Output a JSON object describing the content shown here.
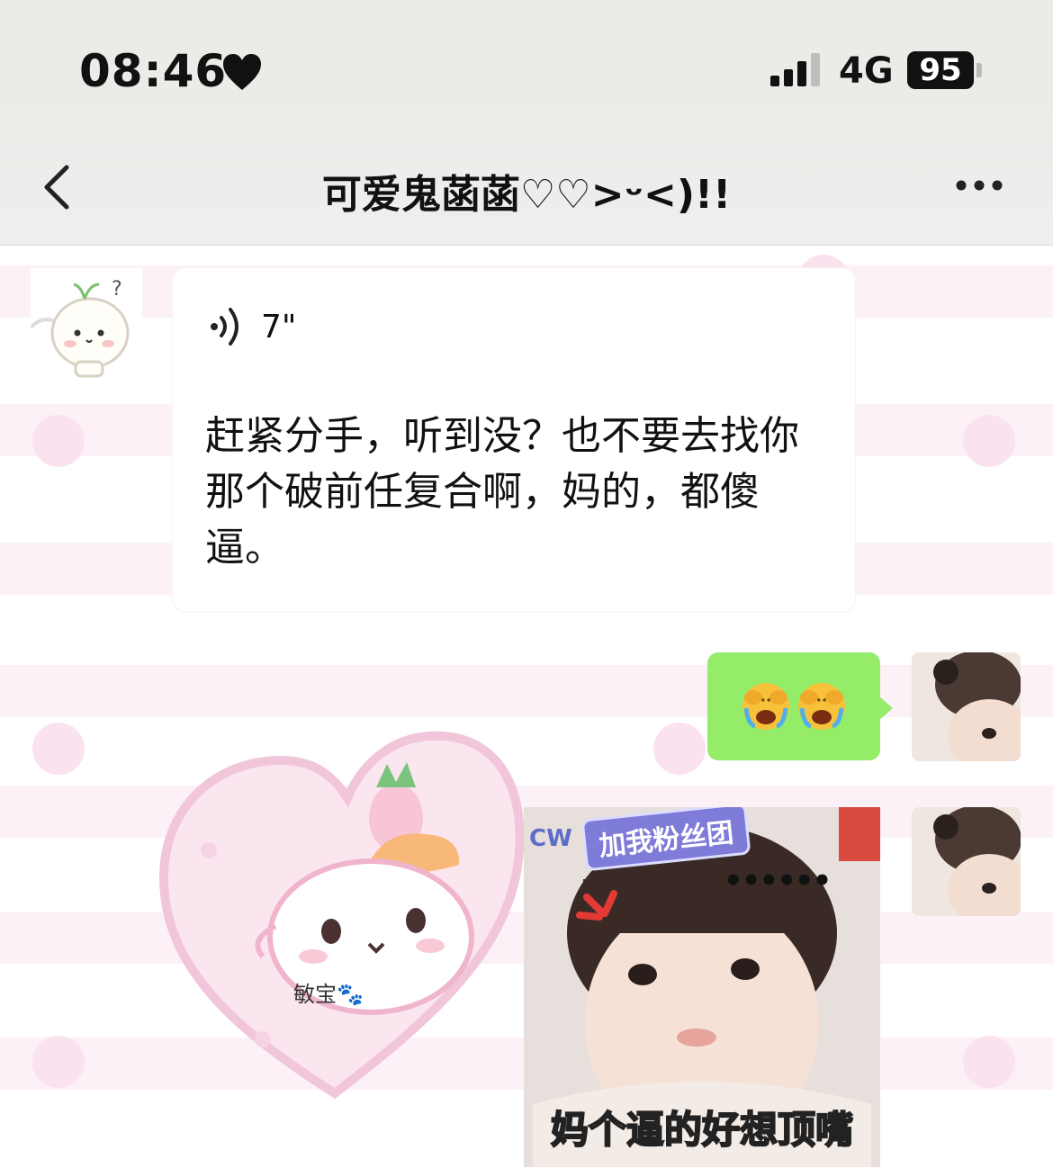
{
  "status_bar": {
    "time": "08:46",
    "network": "4G",
    "battery": "95"
  },
  "nav": {
    "title": "可爱鬼菡菡♡♡>ᵕ<)!!"
  },
  "messages": {
    "incoming_voice": {
      "duration": "7\"",
      "transcript": "赶紧分手，听到没？也不要去找你那个破前任复合啊，妈的，都傻逼。"
    },
    "outgoing_emoji": {
      "emoji": [
        "face-palm-crying-emoji",
        "face-palm-crying-emoji"
      ]
    },
    "background_sticker": {
      "label": "敏宝🐾"
    },
    "sticker_image": {
      "badge": "加我粉丝团",
      "corner_text": "CW",
      "dots": "••••••",
      "caption": "妈个逼的好想顶嘴"
    }
  },
  "colors": {
    "outgoing_bubble": "#95ec69",
    "background_stripe": "#fcf1f6",
    "background_dot": "#fbe2ef"
  }
}
